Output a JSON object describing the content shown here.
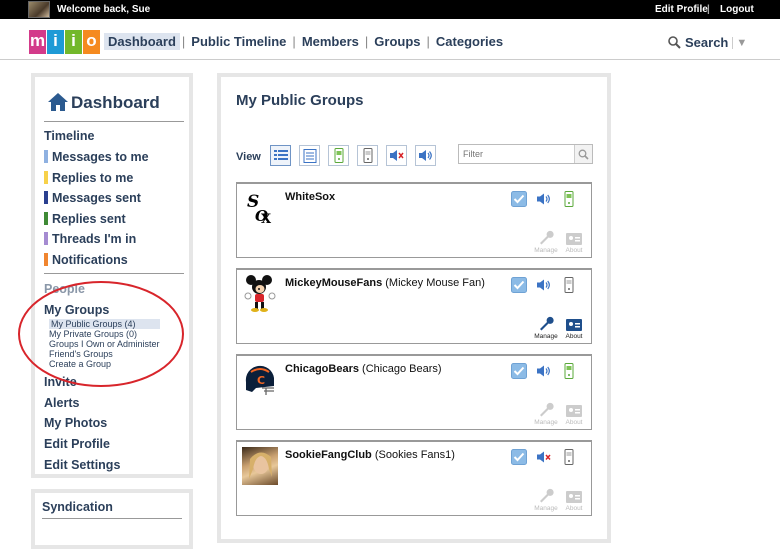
{
  "topbar": {
    "welcome": "Welcome back, Sue",
    "edit_profile": "Edit Profile",
    "separator": "|",
    "logout": "Logout"
  },
  "logo": {
    "letters": [
      "m",
      "i",
      "i",
      "o"
    ],
    "colors": [
      "#d33b8a",
      "#1e9ad6",
      "#73b82b",
      "#f58a1f"
    ]
  },
  "nav": {
    "items": [
      "Dashboard",
      "Public Timeline",
      "Members",
      "Groups",
      "Categories"
    ],
    "separator": "|",
    "active": "Dashboard"
  },
  "search": {
    "label": "Search",
    "icon": "search-icon"
  },
  "sidebar": {
    "title": "Dashboard",
    "timeline": "Timeline",
    "timeline_items": [
      {
        "label": "Messages to me",
        "color": "#8fb1e1"
      },
      {
        "label": "Replies to me",
        "color": "#f7d14a"
      },
      {
        "label": "Messages sent",
        "color": "#2a3f8f"
      },
      {
        "label": "Replies sent",
        "color": "#3f8a35"
      },
      {
        "label": "Threads I'm in",
        "color": "#a58bd1"
      },
      {
        "label": "Notifications",
        "color": "#f0852f"
      }
    ],
    "people": "People",
    "my_groups": "My Groups",
    "group_links": [
      "My Public Groups (4)",
      "My Private Groups (0)",
      "Groups I Own or Administer",
      "Friend's Groups",
      "Create a Group"
    ],
    "active_group_link": "My Public Groups (4)",
    "bottom_links": [
      "Invite",
      "Alerts",
      "My Photos",
      "Edit Profile",
      "Edit Settings"
    ]
  },
  "syndication": {
    "title": "Syndication"
  },
  "main": {
    "title": "My Public Groups",
    "view_label": "View",
    "view_buttons": [
      "detail-list-view-icon",
      "text-list-view-icon",
      "mobile-view-icon",
      "mobile-off-view-icon",
      "muted-view-icon",
      "audio-view-icon"
    ],
    "filter_placeholder": "Filter",
    "groups": [
      {
        "name": "WhiteSox",
        "display": "",
        "avatar": "white-sox-logo",
        "audio_muted": false,
        "mobile_on": true,
        "can_manage": false,
        "manage": "Manage",
        "about": "About"
      },
      {
        "name": "MickeyMouseFans",
        "display": "(Mickey Mouse Fan)",
        "avatar": "mickey-mouse-image",
        "audio_muted": false,
        "mobile_on": false,
        "can_manage": true,
        "manage": "Manage",
        "about": "About"
      },
      {
        "name": "ChicagoBears",
        "display": "(Chicago Bears)",
        "avatar": "chicago-bears-helmet",
        "audio_muted": false,
        "mobile_on": true,
        "can_manage": false,
        "manage": "Manage",
        "about": "About"
      },
      {
        "name": "SookieFangClub",
        "display": "(Sookies Fans1)",
        "avatar": "sookie-photo",
        "audio_muted": true,
        "mobile_on": false,
        "can_manage": false,
        "manage": "Manage",
        "about": "About"
      }
    ]
  },
  "annotation": {
    "color": "#d8252b",
    "shape": "red-ellipse"
  }
}
